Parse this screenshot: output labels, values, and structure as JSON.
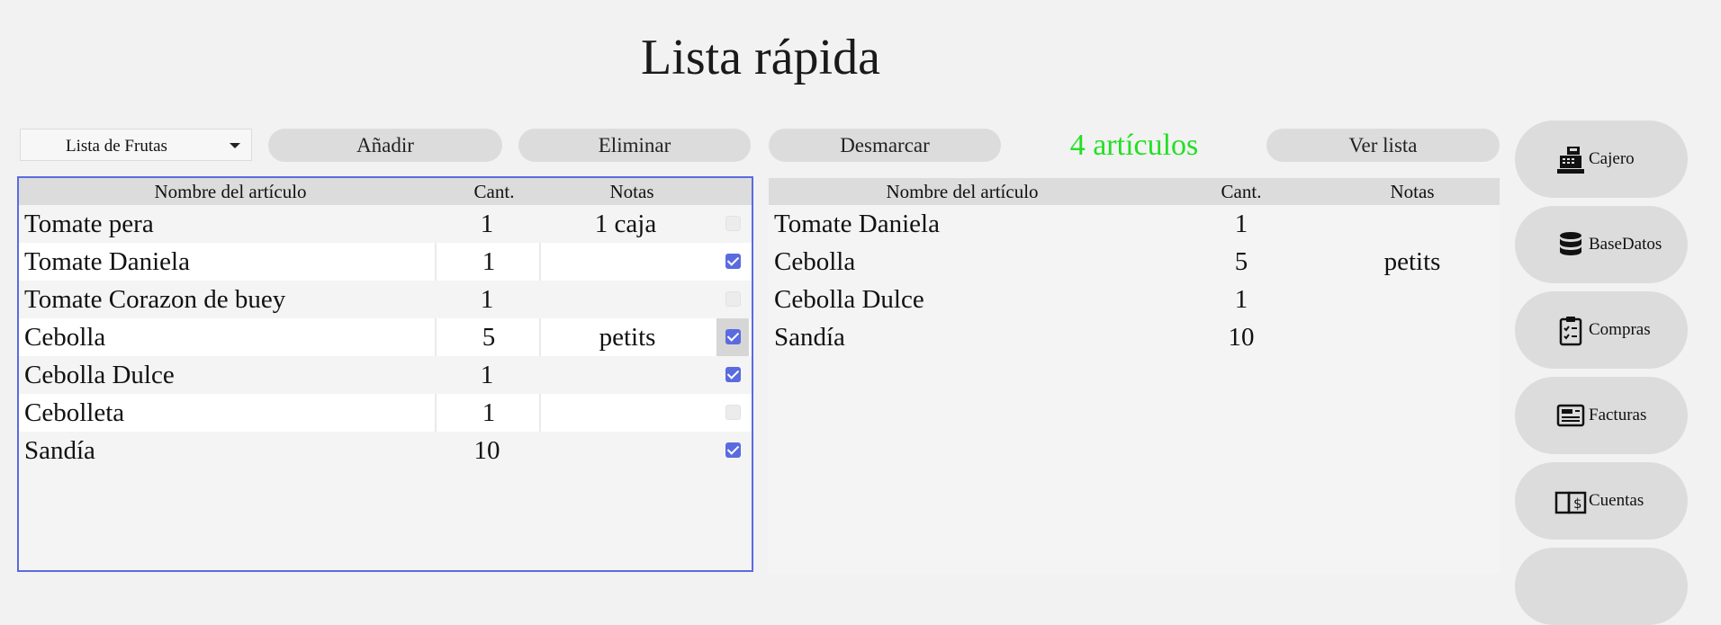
{
  "title": "Lista rápida",
  "list_selector": {
    "selected": "Lista de Frutas"
  },
  "buttons": {
    "add": "Añadir",
    "delete": "Eliminar",
    "unmark": "Desmarcar",
    "view_list": "Ver lista"
  },
  "item_count": "4 artículos",
  "left_table": {
    "headers": {
      "name": "Nombre del artículo",
      "qty": "Cant.",
      "notes": "Notas"
    },
    "rows": [
      {
        "name": "Tomate pera",
        "qty": "1",
        "notes": "1 caja",
        "checked": false
      },
      {
        "name": "Tomate Daniela",
        "qty": "1",
        "notes": "",
        "checked": true
      },
      {
        "name": "Tomate Corazon de buey",
        "qty": "1",
        "notes": "",
        "checked": false
      },
      {
        "name": "Cebolla",
        "qty": "5",
        "notes": "petits",
        "checked": true
      },
      {
        "name": "Cebolla Dulce",
        "qty": "1",
        "notes": "",
        "checked": true
      },
      {
        "name": "Cebolleta",
        "qty": "1",
        "notes": "",
        "checked": false
      },
      {
        "name": "Sandía",
        "qty": "10",
        "notes": "",
        "checked": true
      }
    ]
  },
  "right_table": {
    "headers": {
      "name": "Nombre del artículo",
      "qty": "Cant.",
      "notes": "Notas"
    },
    "rows": [
      {
        "name": "Tomate Daniela",
        "qty": "1",
        "notes": ""
      },
      {
        "name": "Cebolla",
        "qty": "5",
        "notes": "petits"
      },
      {
        "name": "Cebolla Dulce",
        "qty": "1",
        "notes": ""
      },
      {
        "name": "Sandía",
        "qty": "10",
        "notes": ""
      }
    ]
  },
  "sidebar": [
    {
      "label": "Cajero",
      "icon": "cash-register-icon"
    },
    {
      "label": "BaseDatos",
      "icon": "database-icon"
    },
    {
      "label": "Compras",
      "icon": "clipboard-checklist-icon"
    },
    {
      "label": "Facturas",
      "icon": "invoice-icon"
    },
    {
      "label": "Cuentas",
      "icon": "ledger-book-icon"
    }
  ],
  "colors": {
    "accent": "#5a6be0",
    "count_text": "#22e022",
    "button_bg": "#dcdcdc"
  }
}
